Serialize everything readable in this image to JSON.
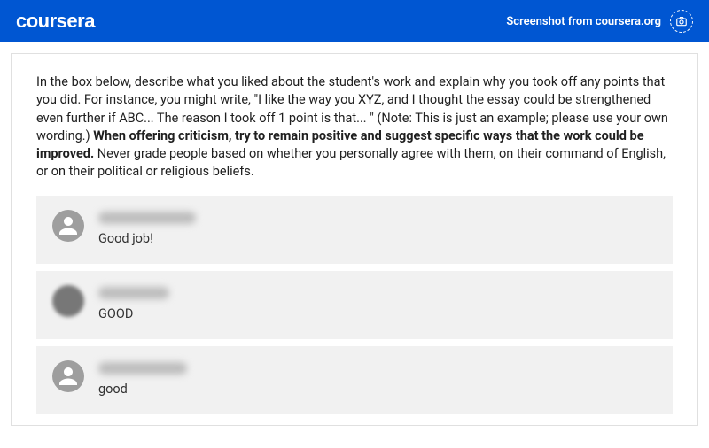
{
  "header": {
    "logo": "coursera",
    "screenshot_label": "Screenshot from coursera.org"
  },
  "instructions": {
    "part1": "In the box below, describe what you liked about the student's work and explain why you took off any points that you did. For instance, you might write, \"I like the way you XYZ, and I thought the essay could be strengthened even further if ABC... The reason I took off 1 point is that... \" (Note: This is just an example; please use your own wording.) ",
    "bold": "When offering criticism, try to remain positive and suggest specific ways that the work could be improved.",
    "part2": " Never grade people based on whether you personally agree with them, on their command of English, or on their political or religious beliefs."
  },
  "comments": [
    {
      "text": "Good job!"
    },
    {
      "text": "GOOD"
    },
    {
      "text": "good"
    }
  ]
}
